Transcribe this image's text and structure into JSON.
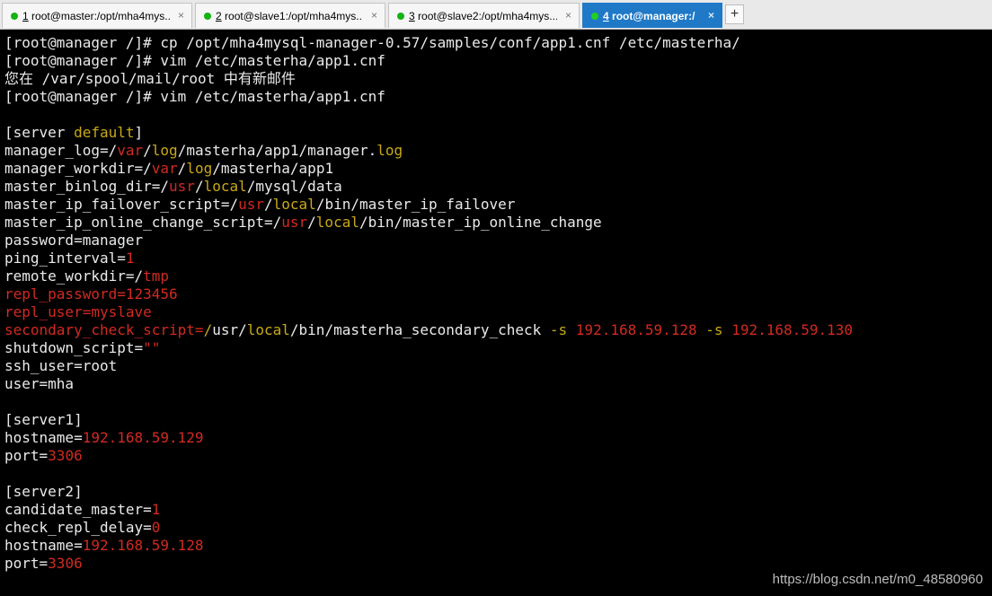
{
  "tabs": [
    {
      "number": "1",
      "label": "root@master:/opt/mha4mys...",
      "active": false,
      "close": "×"
    },
    {
      "number": "2",
      "label": "root@slave1:/opt/mha4mys...",
      "active": false,
      "close": "×"
    },
    {
      "number": "3",
      "label": "root@slave2:/opt/mha4mys...",
      "active": false,
      "close": "×"
    },
    {
      "number": "4",
      "label": "root@manager:/",
      "active": true,
      "close": "×"
    }
  ],
  "new_tab_label": "+",
  "colors": {
    "default_text": "#eaeaea",
    "yellow": "#c9a917",
    "red": "#d12a20",
    "active_tab": "#1f79c7",
    "status_dot": "#12b312"
  },
  "terminal_lines": [
    [
      [
        "w",
        "[root@manager /]# cp /opt/mha4mysql-manager-0.57/samples/conf/app1.cnf /etc/masterha/"
      ]
    ],
    [
      [
        "w",
        "[root@manager /]# vim /etc/masterha/app1.cnf"
      ]
    ],
    [
      [
        "w",
        "您在 /var/spool/mail/root 中有新邮件"
      ]
    ],
    [
      [
        "w",
        "[root@manager /]# vim /etc/masterha/app1.cnf"
      ]
    ],
    [],
    [
      [
        "w",
        "[server "
      ],
      [
        "y",
        "default"
      ],
      [
        "w",
        "]"
      ]
    ],
    [
      [
        "w",
        "manager_log=/"
      ],
      [
        "r",
        "var"
      ],
      [
        "w",
        "/"
      ],
      [
        "y",
        "log"
      ],
      [
        "w",
        "/masterha/app1/manager."
      ],
      [
        "y",
        "log"
      ]
    ],
    [
      [
        "w",
        "manager_workdir=/"
      ],
      [
        "r",
        "var"
      ],
      [
        "w",
        "/"
      ],
      [
        "y",
        "log"
      ],
      [
        "w",
        "/masterha/app1"
      ]
    ],
    [
      [
        "w",
        "master_binlog_dir=/"
      ],
      [
        "r",
        "usr"
      ],
      [
        "w",
        "/"
      ],
      [
        "y",
        "local"
      ],
      [
        "w",
        "/mysql/data"
      ]
    ],
    [
      [
        "w",
        "master_ip_failover_script=/"
      ],
      [
        "r",
        "usr"
      ],
      [
        "w",
        "/"
      ],
      [
        "y",
        "local"
      ],
      [
        "w",
        "/bin/master_ip_failover"
      ]
    ],
    [
      [
        "w",
        "master_ip_online_change_script=/"
      ],
      [
        "r",
        "usr"
      ],
      [
        "w",
        "/"
      ],
      [
        "y",
        "local"
      ],
      [
        "w",
        "/bin/master_ip_online_change"
      ]
    ],
    [
      [
        "w",
        "password=manager"
      ]
    ],
    [
      [
        "w",
        "ping_interval="
      ],
      [
        "r",
        "1"
      ]
    ],
    [
      [
        "w",
        "remote_workdir=/"
      ],
      [
        "r",
        "tmp"
      ]
    ],
    [
      [
        "r",
        "repl_password=123456"
      ]
    ],
    [
      [
        "r",
        "repl_user=myslave"
      ]
    ],
    [
      [
        "r",
        "secondary_check_script="
      ],
      [
        "y",
        "/"
      ],
      [
        "w",
        "usr/"
      ],
      [
        "y",
        "local"
      ],
      [
        "w",
        "/bin/masterha_secondary_check "
      ],
      [
        "y",
        "-s"
      ],
      [
        "w",
        " "
      ],
      [
        "r",
        "192.168.59.128"
      ],
      [
        "w",
        " "
      ],
      [
        "y",
        "-s"
      ],
      [
        "w",
        " "
      ],
      [
        "r",
        "192.168.59.130"
      ]
    ],
    [
      [
        "w",
        "shutdown_script="
      ],
      [
        "r",
        "\"\""
      ]
    ],
    [
      [
        "w",
        "ssh_user=root"
      ]
    ],
    [
      [
        "w",
        "user=mha"
      ]
    ],
    [],
    [
      [
        "w",
        "[server1]"
      ]
    ],
    [
      [
        "w",
        "hostname="
      ],
      [
        "r",
        "192.168.59.129"
      ]
    ],
    [
      [
        "w",
        "port="
      ],
      [
        "r",
        "3306"
      ]
    ],
    [],
    [
      [
        "w",
        "[server2]"
      ]
    ],
    [
      [
        "w",
        "candidate_master="
      ],
      [
        "r",
        "1"
      ]
    ],
    [
      [
        "w",
        "check_repl_delay="
      ],
      [
        "r",
        "0"
      ]
    ],
    [
      [
        "w",
        "hostname="
      ],
      [
        "r",
        "192.168.59.128"
      ]
    ],
    [
      [
        "w",
        "port="
      ],
      [
        "r",
        "3306"
      ]
    ]
  ],
  "watermark": "https://blog.csdn.net/m0_48580960"
}
